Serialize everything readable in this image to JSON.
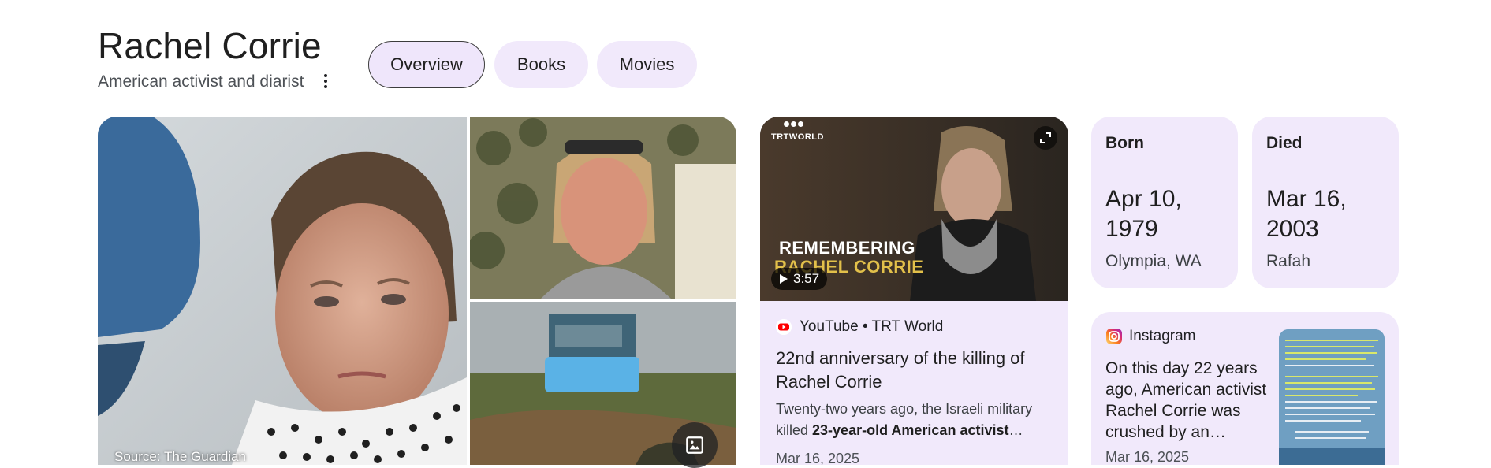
{
  "header": {
    "title": "Rachel Corrie",
    "subtitle": "American activist and diarist"
  },
  "tabs": [
    {
      "label": "Overview",
      "active": true
    },
    {
      "label": "Books",
      "active": false
    },
    {
      "label": "Movies",
      "active": false
    }
  ],
  "images": {
    "source": "Source: The Guardian"
  },
  "video": {
    "brand": "TRTWORLD",
    "overlay_line1": "REMEMBERING",
    "overlay_line2": "RACHEL CORRIE",
    "duration": "3:57",
    "source": "YouTube • TRT World",
    "title": "22nd anniversary of the killing of Rachel Corrie",
    "snippet_pre": "Twenty-two years ago, the Israeli military killed ",
    "snippet_bold": "23-year-old American activist",
    "snippet_post": "…",
    "date": "Mar 16, 2025"
  },
  "facts": {
    "born": {
      "label": "Born",
      "date": "Apr 10, 1979",
      "place": "Olympia, WA"
    },
    "died": {
      "label": "Died",
      "date": "Mar 16, 2003",
      "place": "Rafah"
    }
  },
  "instagram": {
    "source": "Instagram",
    "text": "On this day 22 years ago, American ac­tivist Rachel Corrie was crushed by an…",
    "date": "Mar 16, 2025"
  },
  "colors": {
    "chip_bg": "#f1e9fb",
    "card_bg": "#f1e9fb",
    "youtube_red": "#ff0000",
    "rc_name_gold": "#e2c04a"
  },
  "icons": {
    "more": "more-vert-icon",
    "image_search": "image-icon",
    "expand": "expand-icon",
    "play": "play-icon",
    "youtube": "youtube-icon",
    "instagram": "instagram-icon"
  }
}
